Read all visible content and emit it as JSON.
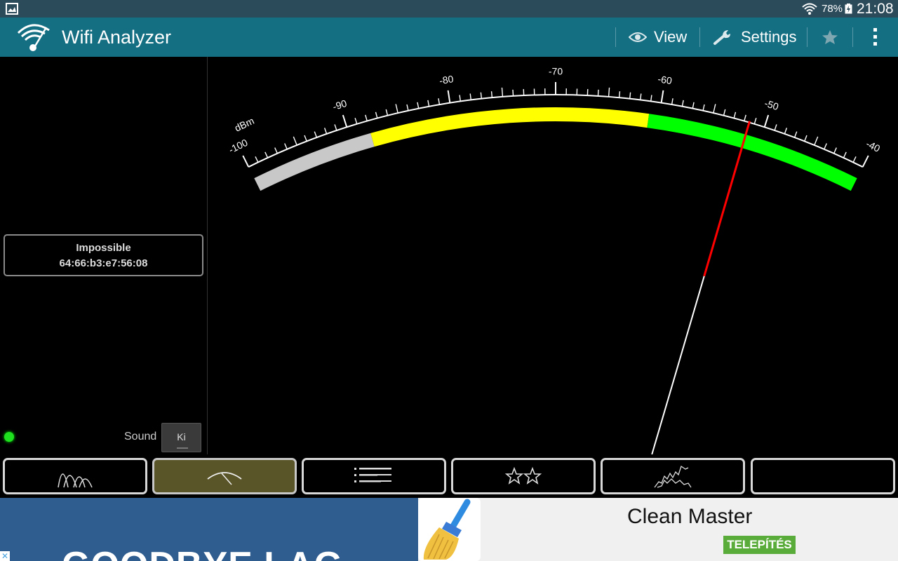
{
  "status_bar": {
    "battery_text": "78%",
    "time": "21:08",
    "icons": [
      "gallery-icon",
      "wifi-icon",
      "battery-charging-icon"
    ]
  },
  "action_bar": {
    "title": "Wifi Analyzer",
    "view_label": "View",
    "settings_label": "Settings",
    "icons": [
      "wifi-analyzer-logo-icon",
      "eye-icon",
      "wrench-icon",
      "star-icon",
      "overflow-menu-icon"
    ]
  },
  "access_point": {
    "ssid": "Impossible",
    "bssid": "64:66:b3:e7:56:08"
  },
  "sound": {
    "label": "Sound",
    "toggle_text": "Ki"
  },
  "meter": {
    "unit_label": "dBm",
    "min": -100,
    "max": -40,
    "major_ticks": [
      -100,
      -90,
      -80,
      -70,
      -60,
      -50,
      -40
    ],
    "major_tick_labels": [
      "-100",
      "-90",
      "-80",
      "-70",
      "-60",
      "-50",
      "-40"
    ],
    "zones": [
      {
        "from": -100,
        "to": -88,
        "color": "#c8c8c8"
      },
      {
        "from": -88,
        "to": -61,
        "color": "#ffff00"
      },
      {
        "from": -61,
        "to": -40,
        "color": "#00ff00"
      }
    ],
    "needle_value": -51.5,
    "needle_color": "#ff0000"
  },
  "tabs": [
    {
      "name": "tab-channel-graph",
      "icon": "channel-graph-icon",
      "active": false
    },
    {
      "name": "tab-signal-meter",
      "icon": "signal-meter-icon",
      "active": true
    },
    {
      "name": "tab-ap-list",
      "icon": "ap-list-icon",
      "active": false
    },
    {
      "name": "tab-channel-rating",
      "icon": "channel-rating-stars-icon",
      "active": false
    },
    {
      "name": "tab-time-graph",
      "icon": "time-graph-icon",
      "active": false
    },
    {
      "name": "tab-empty",
      "icon": "",
      "active": false
    }
  ],
  "ad": {
    "headline": "GOODBYE LAG",
    "app_title": "Clean Master",
    "install_label": "TELEPÍTÉS",
    "close_text": "✕",
    "icons": [
      "clean-master-broom-icon",
      "ad-close-icon"
    ]
  }
}
